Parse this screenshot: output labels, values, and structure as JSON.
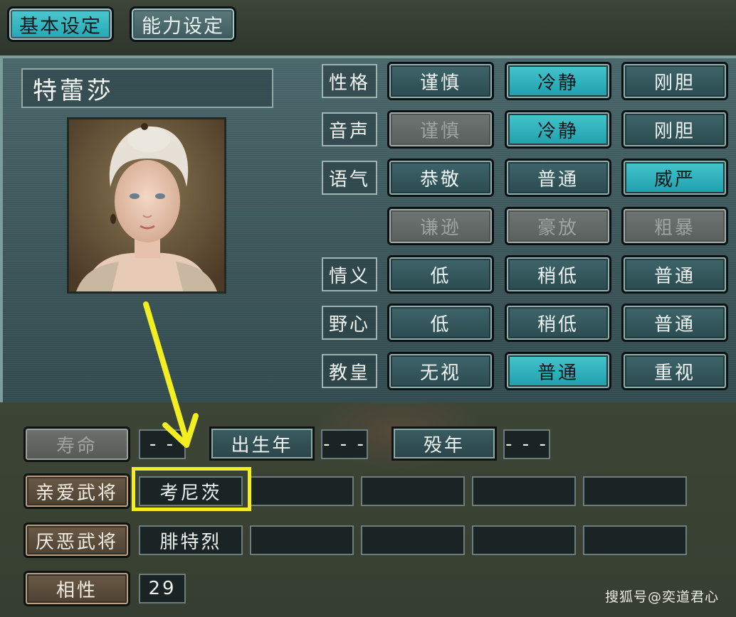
{
  "tabs": [
    {
      "label": "基本设定",
      "active": true
    },
    {
      "label": "能力设定",
      "active": false
    }
  ],
  "character": {
    "name": "特蕾莎",
    "portrait": "portrait-image"
  },
  "attributes": [
    {
      "label": "性格",
      "options": [
        {
          "text": "谨慎",
          "state": "normal"
        },
        {
          "text": "冷静",
          "state": "selected"
        },
        {
          "text": "刚胆",
          "state": "normal"
        }
      ]
    },
    {
      "label": "音声",
      "options": [
        {
          "text": "谨慎",
          "state": "disabled"
        },
        {
          "text": "冷静",
          "state": "selected"
        },
        {
          "text": "刚胆",
          "state": "normal"
        }
      ]
    },
    {
      "label": "语气",
      "options": [
        {
          "text": "恭敬",
          "state": "normal"
        },
        {
          "text": "普通",
          "state": "normal"
        },
        {
          "text": "威严",
          "state": "selected"
        }
      ]
    },
    {
      "label": "",
      "options": [
        {
          "text": "谦逊",
          "state": "disabled"
        },
        {
          "text": "豪放",
          "state": "disabled"
        },
        {
          "text": "粗暴",
          "state": "disabled"
        }
      ]
    },
    {
      "label": "情义",
      "options": [
        {
          "text": "低",
          "state": "normal"
        },
        {
          "text": "稍低",
          "state": "normal"
        },
        {
          "text": "普通",
          "state": "normal"
        }
      ]
    },
    {
      "label": "野心",
      "options": [
        {
          "text": "低",
          "state": "normal"
        },
        {
          "text": "稍低",
          "state": "normal"
        },
        {
          "text": "普通",
          "state": "normal"
        }
      ]
    },
    {
      "label": "教皇",
      "options": [
        {
          "text": "无视",
          "state": "normal"
        },
        {
          "text": "普通",
          "state": "selected"
        },
        {
          "text": "重视",
          "state": "normal"
        }
      ]
    }
  ],
  "lifespan": {
    "label": "寿命",
    "value": "- -",
    "birth_label": "出生年",
    "birth_value": "- - -",
    "death_label": "殁年",
    "death_value": "- - -"
  },
  "favorite": {
    "label": "亲爱武将",
    "values": [
      "考尼茨",
      "",
      "",
      "",
      ""
    ]
  },
  "disliked": {
    "label": "厌恶武将",
    "values": [
      "腓特烈",
      "",
      "",
      "",
      ""
    ]
  },
  "affinity": {
    "label": "相性",
    "value": "29"
  },
  "annotation": {
    "highlight_color": "#f2ee21"
  },
  "watermark": "搜狐号@奕道君心"
}
